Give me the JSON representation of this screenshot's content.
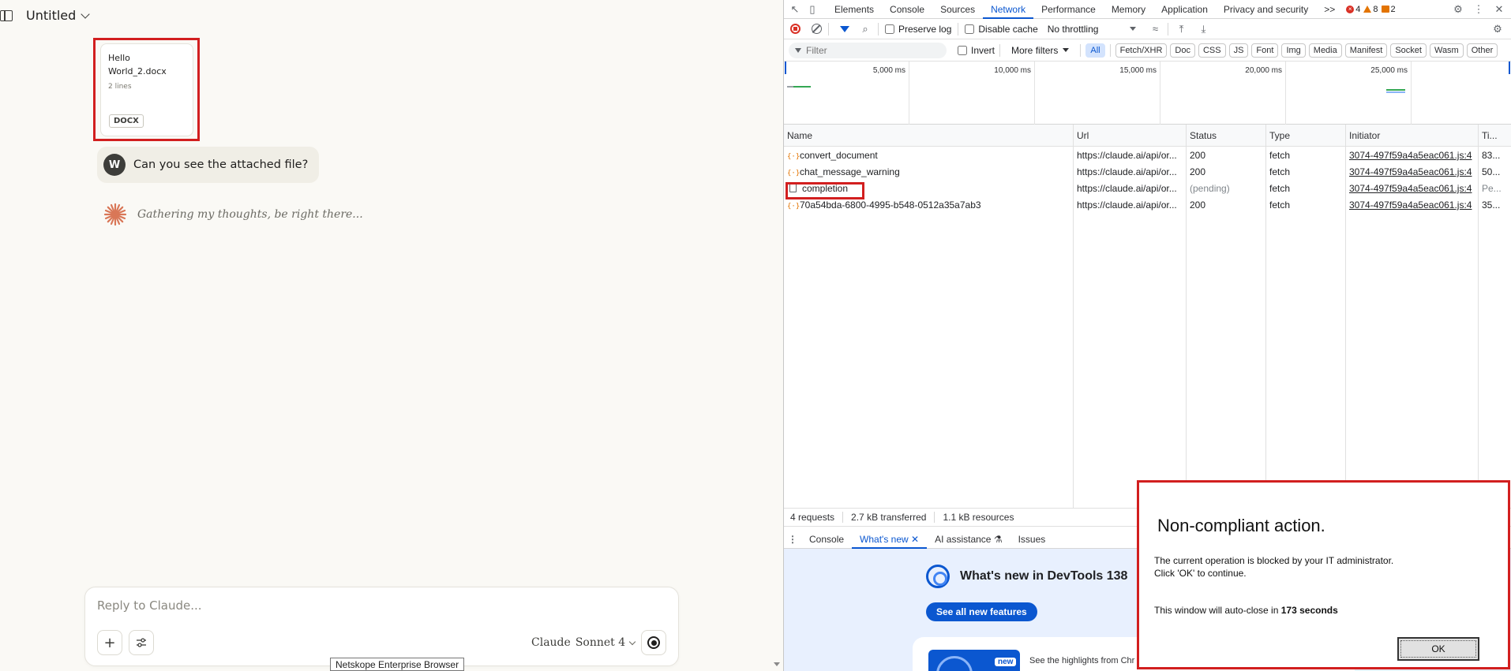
{
  "chat": {
    "title": "Untitled",
    "attachment": {
      "name": "Hello World_2.docx",
      "lines": "2 lines",
      "type": "DOCX"
    },
    "user_message": {
      "avatar_initial": "W",
      "text": "Can you see the attached file?"
    },
    "assistant_status": "Gathering my thoughts, be right there...",
    "composer": {
      "placeholder": "Reply to Claude...",
      "add_label": "+",
      "model_brand": "Claude",
      "model_name": "Sonnet 4"
    },
    "accent_color": "#d97757"
  },
  "status_tooltip": "Netskope Enterprise Browser",
  "devtools": {
    "tabs": [
      "Elements",
      "Console",
      "Sources",
      "Network",
      "Performance",
      "Memory",
      "Application",
      "Privacy and security"
    ],
    "active_tab": "Network",
    "more_tabs": ">>",
    "counts": {
      "errors": "4",
      "warnings": "8",
      "issues": "2"
    },
    "toolbar": {
      "preserve_log": "Preserve log",
      "disable_cache": "Disable cache",
      "throttling": "No throttling"
    },
    "filter": {
      "placeholder": "Filter",
      "invert": "Invert",
      "more_filters": "More filters",
      "types": [
        "All",
        "Fetch/XHR",
        "Doc",
        "CSS",
        "JS",
        "Font",
        "Img",
        "Media",
        "Manifest",
        "Socket",
        "Wasm",
        "Other"
      ],
      "active_type": "All"
    },
    "overview_ticks": [
      "5,000 ms",
      "10,000 ms",
      "15,000 ms",
      "20,000 ms",
      "25,000 ms"
    ],
    "columns": [
      "Name",
      "Url",
      "Status",
      "Type",
      "Initiator",
      "Ti..."
    ],
    "requests": [
      {
        "name": "convert_document",
        "url": "https://claude.ai/api/or...",
        "status": "200",
        "type": "fetch",
        "initiator": "3074-497f59a4a5eac061.js:4",
        "time": "83...",
        "kind": "xhr"
      },
      {
        "name": "chat_message_warning",
        "url": "https://claude.ai/api/or...",
        "status": "200",
        "type": "fetch",
        "initiator": "3074-497f59a4a5eac061.js:4",
        "time": "50...",
        "kind": "xhr"
      },
      {
        "name": "completion",
        "url": "https://claude.ai/api/or...",
        "status": "(pending)",
        "type": "fetch",
        "initiator": "3074-497f59a4a5eac061.js:4",
        "time": "Pe...",
        "kind": "doc"
      },
      {
        "name": "70a54bda-6800-4995-b548-0512a35a7ab3",
        "url": "https://claude.ai/api/or...",
        "status": "200",
        "type": "fetch",
        "initiator": "3074-497f59a4a5eac061.js:4",
        "time": "35...",
        "kind": "xhr"
      }
    ],
    "summary": {
      "requests": "4 requests",
      "transferred": "2.7 kB transferred",
      "resources": "1.1 kB resources"
    },
    "drawer_tabs": [
      "Console",
      "What's new",
      "AI assistance",
      "Issues"
    ],
    "drawer_active": "What's new",
    "whats_new": {
      "title": "What's new in DevTools 138",
      "button": "See all new features",
      "card_badge": "new",
      "card_text": "See the highlights from Chr"
    }
  },
  "modal": {
    "title": "Non-compliant action.",
    "message_line1": "The current operation is blocked by your IT administrator.",
    "message_line2": "Click 'OK' to continue.",
    "countdown_prefix": "This window will auto-close in ",
    "countdown_value": "173 seconds",
    "ok_label": "OK"
  }
}
